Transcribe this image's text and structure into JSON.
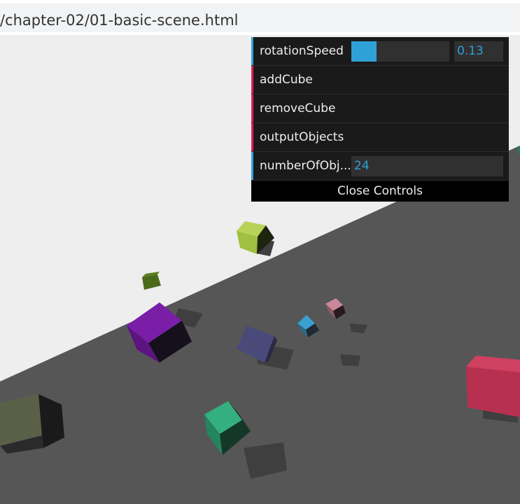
{
  "browser": {
    "url": "/chapter-02/01-basic-scene.html"
  },
  "gui": {
    "rows": [
      {
        "label": "rotationSpeed",
        "kind": "number",
        "value": "0.13",
        "fraction": 0.13
      },
      {
        "label": "addCube",
        "kind": "function"
      },
      {
        "label": "removeCube",
        "kind": "function"
      },
      {
        "label": "outputObjects",
        "kind": "function"
      },
      {
        "label": "numberOfObj...",
        "kind": "number",
        "value": "24"
      }
    ],
    "close_label": "Close Controls",
    "colors": {
      "number": "#2fa1d6",
      "function": "#e61d5f",
      "background": "#1a1a1a"
    }
  },
  "scene": {
    "background_color": "#eeeeee",
    "plane_color": "#555555",
    "cubes": [
      {
        "name": "lime-cube",
        "color": "#9fc040"
      },
      {
        "name": "olive-cube",
        "color": "#4a6a18"
      },
      {
        "name": "purple-cube",
        "color": "#6a1890"
      },
      {
        "name": "slate-cube",
        "color": "#4a4a78"
      },
      {
        "name": "blue-cube",
        "color": "#3aa0d0"
      },
      {
        "name": "pink-cube",
        "color": "#c08090"
      },
      {
        "name": "red-cube",
        "color": "#c03050"
      },
      {
        "name": "green-cube",
        "color": "#30a070"
      },
      {
        "name": "gray-green-cube",
        "color": "#5a6048"
      }
    ]
  }
}
